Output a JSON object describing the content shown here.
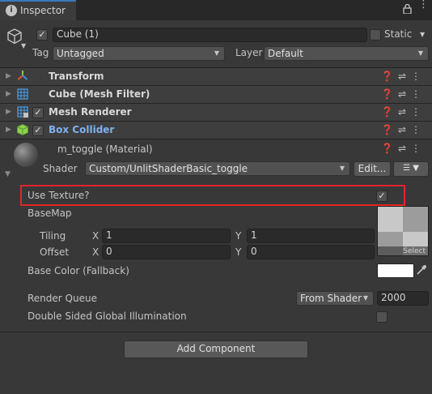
{
  "tab": {
    "title": "Inspector",
    "lock_icon": "lock-icon",
    "menu_icon": "kebab-menu-icon"
  },
  "object": {
    "name": "Cube (1)",
    "active": true,
    "static_label": "Static",
    "tag_label": "Tag",
    "tag_value": "Untagged",
    "layer_label": "Layer",
    "layer_value": "Default"
  },
  "components": [
    {
      "name": "Transform",
      "icon": "transform-icon",
      "has_checkbox": false,
      "highlighted": false
    },
    {
      "name": "Cube (Mesh Filter)",
      "icon": "mesh-filter-icon",
      "has_checkbox": false,
      "highlighted": false
    },
    {
      "name": "Mesh Renderer",
      "icon": "mesh-renderer-icon",
      "has_checkbox": true,
      "highlighted": false
    },
    {
      "name": "Box Collider",
      "icon": "box-collider-icon",
      "has_checkbox": true,
      "highlighted": true
    }
  ],
  "material": {
    "name": "m_toggle (Material)",
    "shader_label": "Shader",
    "shader_value": "Custom/UnlitShaderBasic_toggle",
    "edit_label": "Edit...",
    "use_texture_label": "Use Texture?",
    "use_texture_checked": true,
    "basemap_label": "BaseMap",
    "tiling_label": "Tiling",
    "offset_label": "Offset",
    "x_label": "X",
    "y_label": "Y",
    "tiling_x": "1",
    "tiling_y": "1",
    "offset_x": "0",
    "offset_y": "0",
    "select_label": "Select",
    "base_color_label": "Base Color (Fallback)",
    "base_color": "#ffffff",
    "render_queue_label": "Render Queue",
    "render_queue_mode": "From Shader",
    "render_queue_value": "2000",
    "double_sided_label": "Double Sided Global Illumination",
    "double_sided_checked": false
  },
  "add_component_label": "Add Component",
  "colors": {
    "highlight_border": "#e0262b",
    "selected_component_text": "#7fb2f0",
    "tab_accent": "#3a79bb"
  }
}
